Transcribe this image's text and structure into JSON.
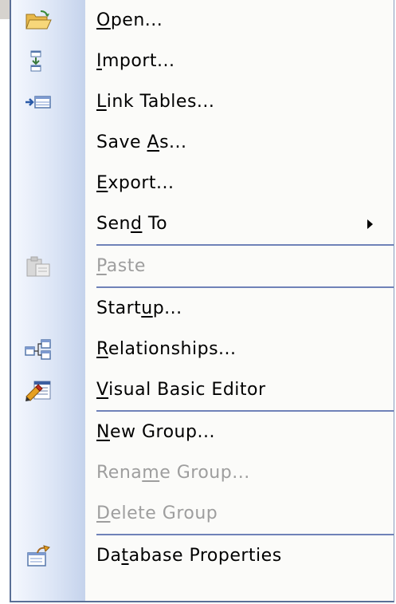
{
  "menu": {
    "items": [
      {
        "name": "open",
        "pre": "",
        "key": "O",
        "post": "pen...",
        "disabled": false,
        "icon": "open-folder-icon"
      },
      {
        "name": "import",
        "pre": "",
        "key": "I",
        "post": "mport...",
        "disabled": false,
        "icon": "import-icon"
      },
      {
        "name": "link-tables",
        "pre": "",
        "key": "L",
        "post": "ink Tables...",
        "disabled": false,
        "icon": "link-tables-icon"
      },
      {
        "name": "save-as",
        "pre": "Save ",
        "key": "A",
        "post": "s...",
        "disabled": false,
        "icon": ""
      },
      {
        "name": "export",
        "pre": "",
        "key": "E",
        "post": "xport...",
        "disabled": false,
        "icon": ""
      },
      {
        "name": "send-to",
        "pre": "Sen",
        "key": "d",
        "post": " To",
        "disabled": false,
        "icon": "",
        "submenu_arrow": "submenu-arrow-icon"
      },
      {
        "name": "paste",
        "pre": "",
        "key": "P",
        "post": "aste",
        "disabled": true,
        "icon": "paste-icon"
      },
      {
        "name": "startup",
        "pre": "Start",
        "key": "u",
        "post": "p...",
        "disabled": false,
        "icon": ""
      },
      {
        "name": "relationships",
        "pre": "",
        "key": "R",
        "post": "elationships...",
        "disabled": false,
        "icon": "relationships-icon"
      },
      {
        "name": "visual-basic-editor",
        "pre": "",
        "key": "V",
        "post": "isual Basic Editor",
        "disabled": false,
        "icon": "visual-basic-editor-icon"
      },
      {
        "name": "new-group",
        "pre": "",
        "key": "N",
        "post": "ew Group...",
        "disabled": false,
        "icon": ""
      },
      {
        "name": "rename-group",
        "pre": "Rena",
        "key": "m",
        "post": "e Group...",
        "disabled": true,
        "icon": ""
      },
      {
        "name": "delete-group",
        "pre": "",
        "key": "D",
        "post": "elete Group",
        "disabled": true,
        "icon": ""
      },
      {
        "name": "database-properties",
        "pre": "Da",
        "key": "t",
        "post": "abase Properties",
        "disabled": false,
        "icon": "database-properties-icon"
      }
    ]
  },
  "colors": {
    "border": "#5a6f96",
    "separator": "#6f82b8",
    "disabled_text": "#9e9e9e"
  }
}
